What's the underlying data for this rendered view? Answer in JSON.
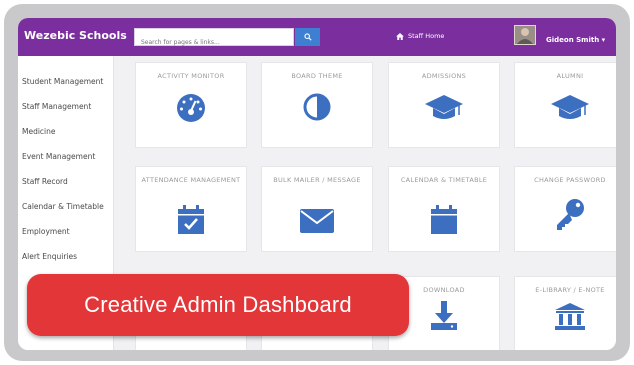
{
  "header": {
    "brand": "Wezebic Schools",
    "search_placeholder": "Search for pages & links...",
    "staff_home": "Staff Home",
    "user_name": "Gideon Smith ▾"
  },
  "sidebar": {
    "items": [
      {
        "label": "Student Management"
      },
      {
        "label": "Staff Management"
      },
      {
        "label": "Medicine"
      },
      {
        "label": "Event Management"
      },
      {
        "label": "Staff Record"
      },
      {
        "label": "Calendar & Timetable"
      },
      {
        "label": "Employment"
      },
      {
        "label": "Alert Enquiries"
      }
    ]
  },
  "tiles": [
    {
      "title": "ACTIVITY MONITOR",
      "icon": "dashboard-icon"
    },
    {
      "title": "BOARD THEME",
      "icon": "contrast-icon"
    },
    {
      "title": "ADMISSIONS",
      "icon": "graduation-cap-icon"
    },
    {
      "title": "ALUMNI",
      "icon": "graduation-cap-icon"
    },
    {
      "title": "ATTENDANCE MANAGEMENT",
      "icon": "calendar-check-icon"
    },
    {
      "title": "BULK MAILER / MESSAGE",
      "icon": "envelope-icon"
    },
    {
      "title": "CALENDAR & TIMETABLE",
      "icon": "calendar-icon"
    },
    {
      "title": "CHANGE PASSWORD",
      "icon": "key-icon"
    },
    {
      "title": "DOWNLOAD",
      "icon": "download-icon"
    },
    {
      "title": "E-LIBRARY / E-NOTE",
      "icon": "library-icon"
    }
  ],
  "banner": {
    "text": "Creative Admin Dashboard"
  },
  "colors": {
    "topbar": "#7b2f9e",
    "icon": "#3d6fc0",
    "banner": "#e23638"
  }
}
